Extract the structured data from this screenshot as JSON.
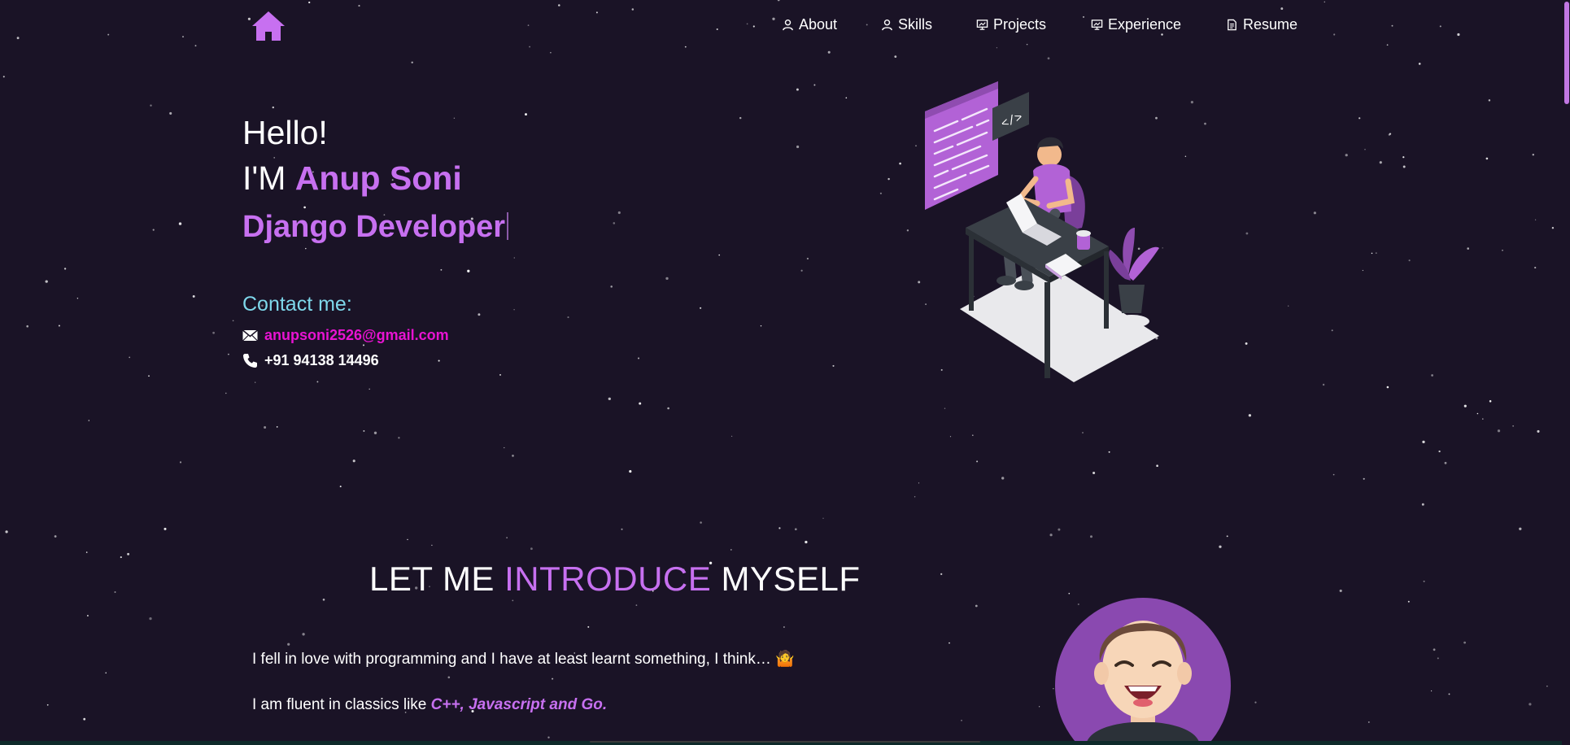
{
  "colors": {
    "background": "#1a1326",
    "accent": "#c770f0",
    "contact_title": "#7ed7ea",
    "email": "#e813d2",
    "text": "#ffffff"
  },
  "navbar": {
    "home_icon": "home-icon",
    "items": [
      {
        "label": "About",
        "icon": "user-icon"
      },
      {
        "label": "Skills",
        "icon": "user-icon"
      },
      {
        "label": "Projects",
        "icon": "presentation-icon"
      },
      {
        "label": "Experience",
        "icon": "presentation-icon"
      },
      {
        "label": "Resume",
        "icon": "document-icon"
      }
    ]
  },
  "hero": {
    "greeting": "Hello!",
    "im_prefix": "I'M",
    "name": "Anup Soni",
    "role": "Django Developer",
    "contact_title": "Contact me:",
    "email": "anupsoni2526@gmail.com",
    "phone": "+91 94138 14496",
    "email_icon": "envelope-icon",
    "phone_icon": "phone-icon"
  },
  "intro": {
    "heading_part1": "LET ME",
    "heading_accent": "INTRODUCE",
    "heading_part2": "MYSELF",
    "p1": "I fell in love with programming and I have at least learnt something, I think… 🤷",
    "p2_prefix": "I am fluent in classics like",
    "p2_accent": "C++, Javascript and Go."
  }
}
